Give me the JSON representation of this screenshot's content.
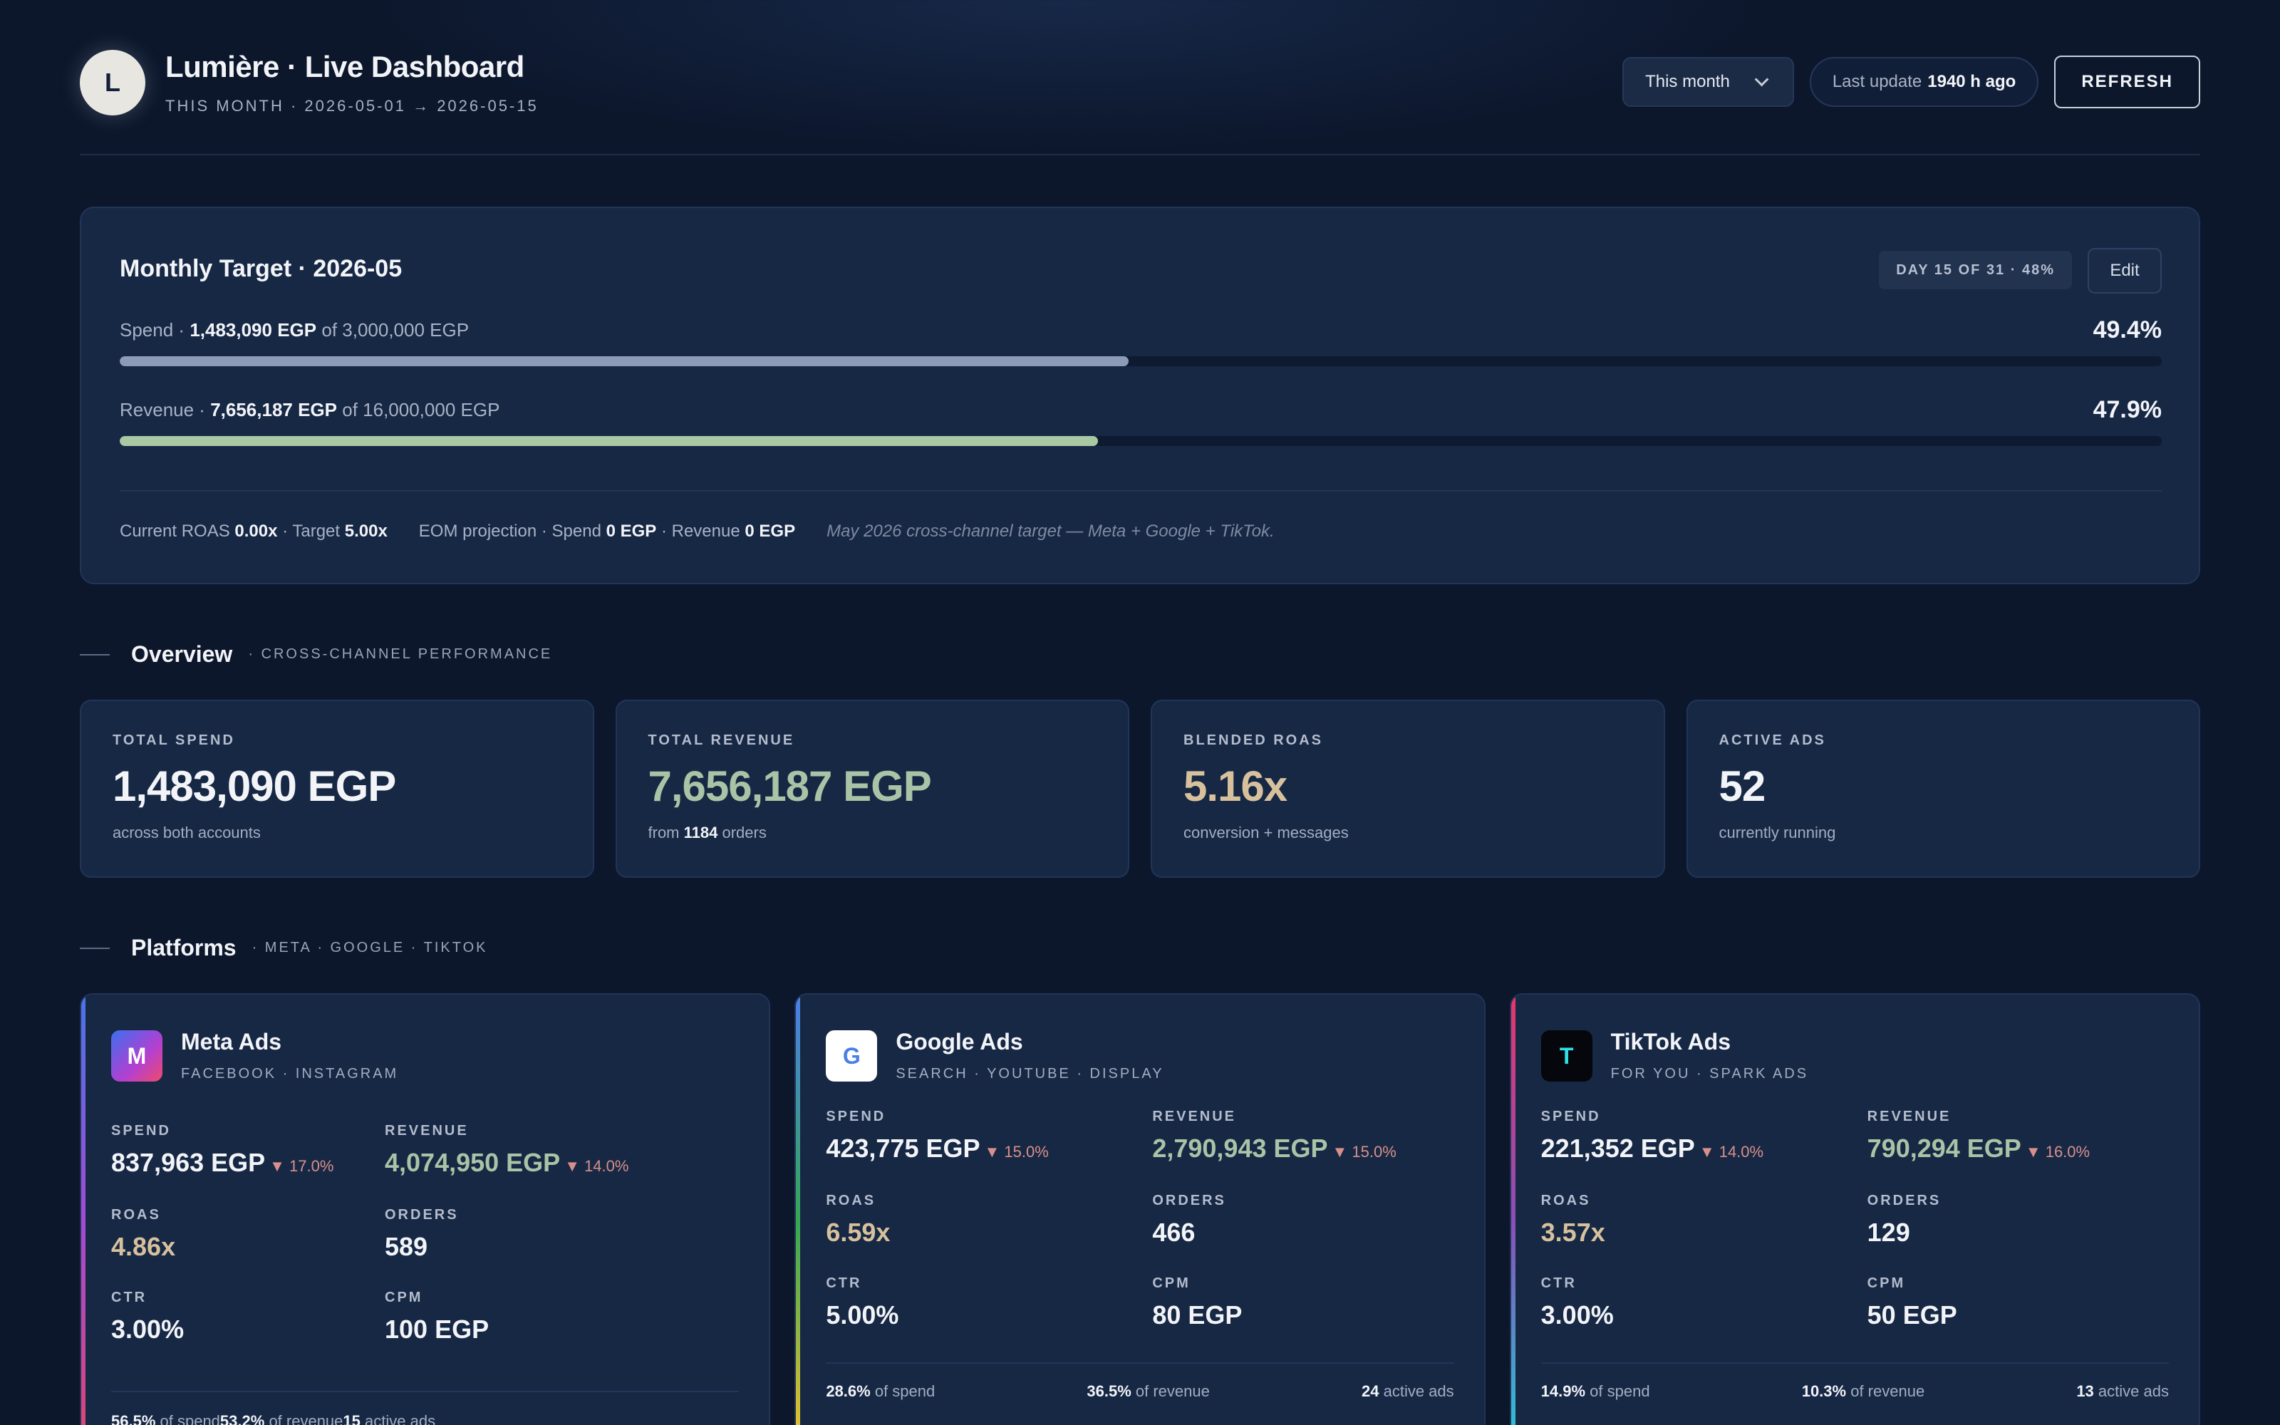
{
  "header": {
    "logo_letter": "L",
    "title": "Lumière · Live Dashboard",
    "subtitle": "THIS MONTH · 2026-05-01 → 2026-05-15",
    "period_select": "This month",
    "last_update_prefix": "Last update",
    "last_update_value": "1940 h ago",
    "refresh_label": "REFRESH"
  },
  "target": {
    "title": "Monthly Target · 2026-05",
    "day_badge": "DAY 15 OF 31 · 48%",
    "edit_label": "Edit",
    "spend": {
      "label": "Spend ·",
      "value": "1,483,090 EGP",
      "of_text": "of 3,000,000 EGP",
      "pct_text": "49.4%",
      "progress": 0.494
    },
    "revenue": {
      "label": "Revenue ·",
      "value": "7,656,187 EGP",
      "of_text": "of 16,000,000 EGP",
      "pct_text": "47.9%",
      "progress": 0.479
    },
    "footer": {
      "roas_label": "Current ROAS",
      "roas_value": "0.00x",
      "target_label": "· Target",
      "target_value": "5.00x",
      "eom_label": "EOM projection · Spend",
      "eom_spend": "0 EGP",
      "eom_rev_label": "· Revenue",
      "eom_rev": "0 EGP",
      "note": "May 2026 cross-channel target — Meta + Google + TikTok."
    }
  },
  "overview": {
    "title": "Overview",
    "tag": "· CROSS-CHANNEL PERFORMANCE",
    "kpis": [
      {
        "label": "TOTAL SPEND",
        "value": "1,483,090 EGP",
        "sub": "across both accounts",
        "color": "#f2f4f8"
      },
      {
        "label": "TOTAL REVENUE",
        "value": "7,656,187 EGP",
        "sub_prefix": "from",
        "sub_bold": "1184",
        "sub_suffix": "orders",
        "color": "#a9c3a6"
      },
      {
        "label": "BLENDED ROAS",
        "value": "5.16x",
        "sub": "conversion + messages",
        "color": "#d7c19d"
      },
      {
        "label": "ACTIVE ADS",
        "value": "52",
        "sub": "currently running",
        "color": "#f2f4f8"
      }
    ]
  },
  "platforms_section": {
    "title": "Platforms",
    "tag": "· META · GOOGLE · TIKTOK"
  },
  "platforms": [
    {
      "name": "Meta Ads",
      "tags": "FACEBOOK · INSTAGRAM",
      "logo": "M",
      "spend": "837,963 EGP",
      "spend_delta": "▼ 17.0%",
      "revenue": "4,074,950 EGP",
      "revenue_delta": "▼ 14.0%",
      "roas": "4.86x",
      "orders": "589",
      "ctr": "3.00%",
      "cpm": "100 EGP",
      "share_spend": "56.5%",
      "share_spend_label": "of spend",
      "share_revenue": "53.2%",
      "share_revenue_label": "of revenue",
      "active_ads": "15",
      "active_ads_label": "active ads"
    },
    {
      "name": "Google Ads",
      "tags": "SEARCH · YOUTUBE · DISPLAY",
      "logo": "G",
      "spend": "423,775 EGP",
      "spend_delta": "▼ 15.0%",
      "revenue": "2,790,943 EGP",
      "revenue_delta": "▼ 15.0%",
      "roas": "6.59x",
      "orders": "466",
      "ctr": "5.00%",
      "cpm": "80 EGP",
      "share_spend": "28.6%",
      "share_spend_label": "of spend",
      "share_revenue": "36.5%",
      "share_revenue_label": "of revenue",
      "active_ads": "24",
      "active_ads_label": "active ads"
    },
    {
      "name": "TikTok Ads",
      "tags": "FOR YOU · SPARK ADS",
      "logo": "T",
      "spend": "221,352 EGP",
      "spend_delta": "▼ 14.0%",
      "revenue": "790,294 EGP",
      "revenue_delta": "▼ 16.0%",
      "roas": "3.57x",
      "orders": "129",
      "ctr": "3.00%",
      "cpm": "50 EGP",
      "share_spend": "14.9%",
      "share_spend_label": "of spend",
      "share_revenue": "10.3%",
      "share_revenue_label": "of revenue",
      "active_ads": "13",
      "active_ads_label": "active ads"
    }
  ],
  "metric_labels": {
    "spend": "SPEND",
    "revenue": "REVENUE",
    "roas": "ROAS",
    "orders": "ORDERS",
    "ctr": "CTR",
    "cpm": "CPM"
  },
  "colors": {
    "spend_bar": "#8c9bb8",
    "revenue_bar": "#a9c9a4",
    "revenue_text": "#a9c3a6",
    "roas_text": "#d7c19d",
    "delta_down": "#d8908a"
  }
}
